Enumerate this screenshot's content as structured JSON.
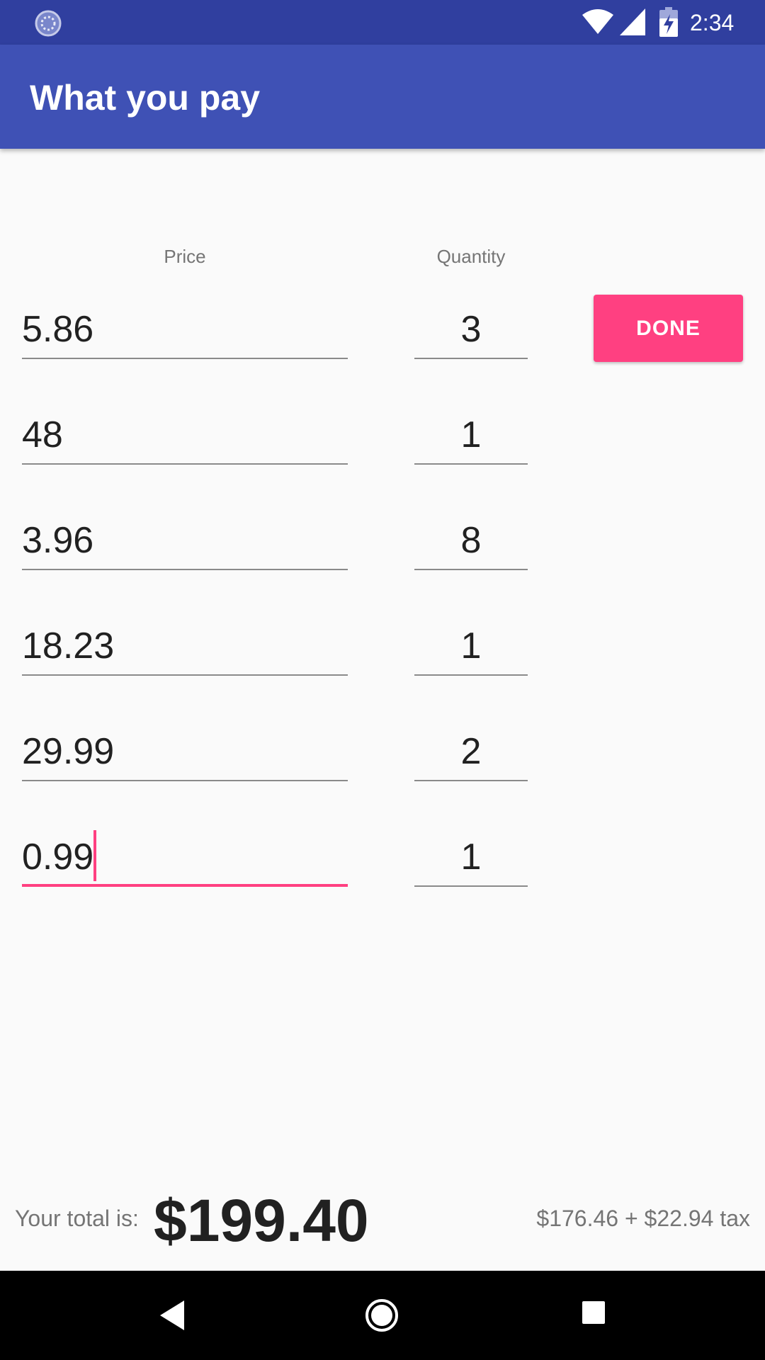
{
  "status_bar": {
    "time": "2:34",
    "icons": [
      "sync-icon",
      "wifi-icon",
      "signal-icon",
      "battery-charging-icon"
    ]
  },
  "app_bar": {
    "title": "What you pay"
  },
  "columns": {
    "price_label": "Price",
    "quantity_label": "Quantity"
  },
  "rows": [
    {
      "price": "5.86",
      "quantity": "3"
    },
    {
      "price": "48",
      "quantity": "1"
    },
    {
      "price": "3.96",
      "quantity": "8"
    },
    {
      "price": "18.23",
      "quantity": "1"
    },
    {
      "price": "29.99",
      "quantity": "2"
    },
    {
      "price": "0.99",
      "quantity": "1"
    }
  ],
  "active_field": "rows.5.price",
  "done_button": {
    "label": "DONE"
  },
  "total": {
    "label": "Your total is:",
    "amount": "$199.40",
    "breakdown": "$176.46 + $22.94 tax"
  },
  "nav_bar": {
    "icons": [
      "back-icon",
      "home-icon",
      "recents-icon"
    ]
  },
  "colors": {
    "status_bar": "#303f9f",
    "app_bar": "#3f51b5",
    "accent": "#ff4081",
    "background": "#fafafa"
  }
}
